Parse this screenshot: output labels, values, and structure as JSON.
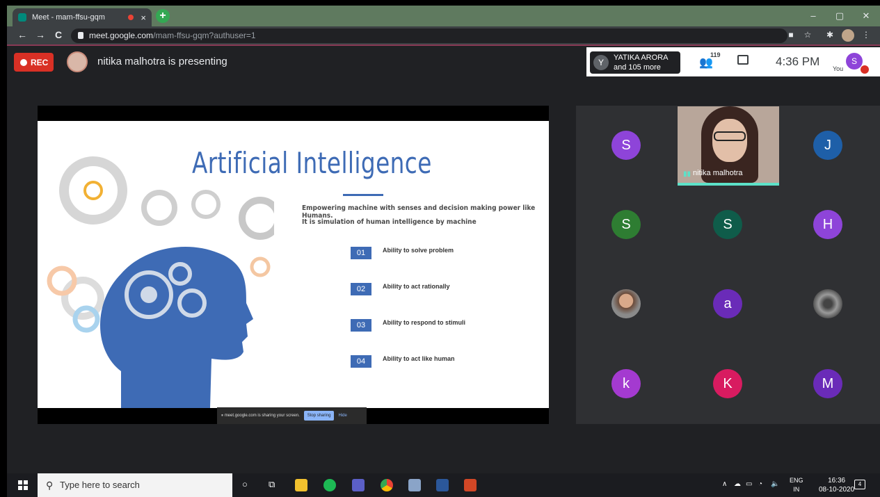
{
  "browser": {
    "tab_title": "Meet - mam-ffsu-gqm",
    "tab_close": "×",
    "new_tab": "+",
    "url_host": "meet.google.com",
    "url_path": "/mam-ffsu-gqm?authuser=1",
    "back": "←",
    "forward": "→",
    "reload": "C",
    "minimize": "–",
    "maximize": "▢",
    "close": "✕"
  },
  "meet": {
    "rec_label": "REC",
    "presenting_text": "nitika malhotra is presenting",
    "people_chip": {
      "avatar_letter": "Y",
      "line1": "YATIKA ARORA",
      "line2": "and 105 more"
    },
    "participant_count": "119",
    "time": "4:36 PM",
    "you_label": "You",
    "you_avatar": "S",
    "share_notice": "meet.google.com is sharing your screen.",
    "stop_sharing": "Stop sharing",
    "hide": "Hide"
  },
  "slide": {
    "title": "Artificial Intelligence",
    "desc_line1": "Empowering machine with senses and decision making power like Humans.",
    "desc_line2": "It is simulation of human intelligence by machine",
    "abilities": [
      {
        "num": "01",
        "text": "Ability to solve problem"
      },
      {
        "num": "02",
        "text": "Ability to act rationally"
      },
      {
        "num": "03",
        "text": "Ability to respond to stimuli"
      },
      {
        "num": "04",
        "text": "Ability to act like human"
      }
    ]
  },
  "participants": [
    {
      "letter": "S",
      "color": "#8e44d9"
    },
    {
      "letter": "J",
      "color": "#1e5fa8"
    },
    {
      "letter": "S",
      "color": "#2e7d32"
    },
    {
      "letter": "S",
      "color": "#0f5c4a"
    },
    {
      "letter": "H",
      "color": "#8e44d9"
    },
    {
      "letter": "a",
      "color": "#6a2bb8"
    },
    {
      "letter": "k",
      "color": "#a43ad0"
    },
    {
      "letter": "K",
      "color": "#d81b60"
    },
    {
      "letter": "M",
      "color": "#6a2bb8"
    }
  ],
  "presenter_tile_name": "nitika malhotra",
  "taskbar": {
    "search_placeholder": "Type here to search",
    "lang1": "ENG",
    "lang2": "IN",
    "clock_time": "16:36",
    "clock_date": "08-10-2020",
    "notif_count": "4"
  }
}
